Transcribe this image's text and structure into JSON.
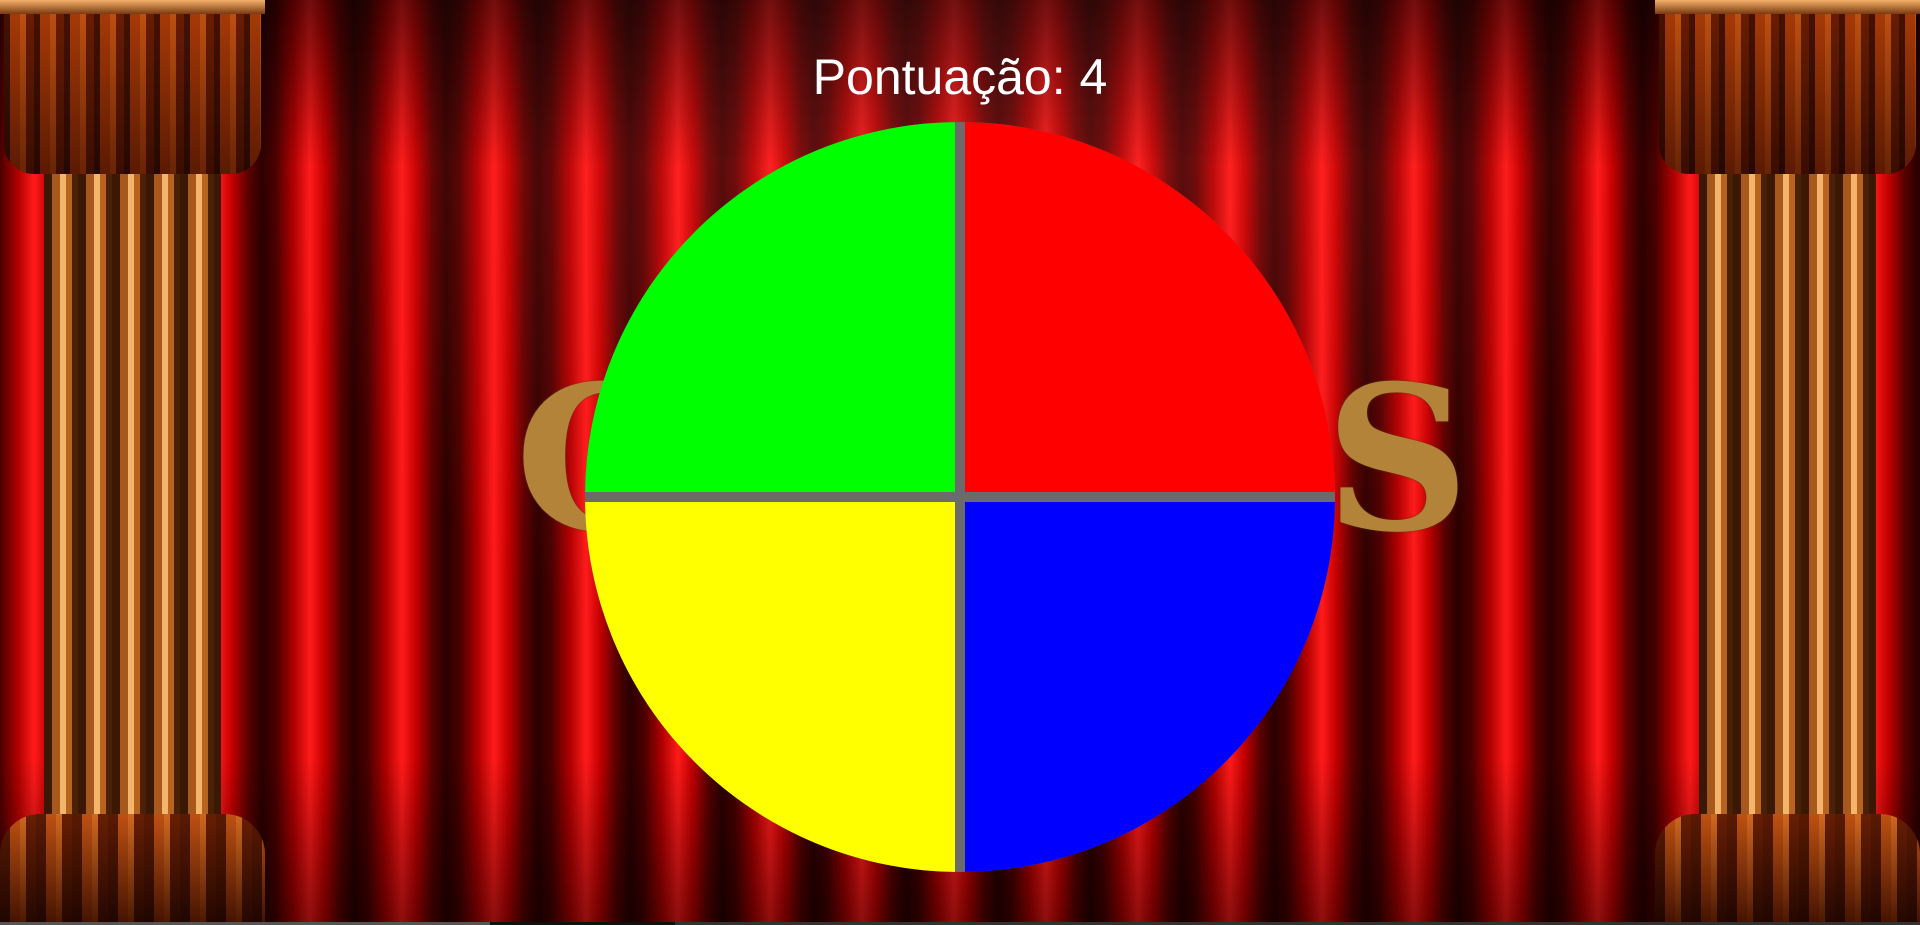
{
  "score": {
    "text": "Pontuação: 4"
  },
  "background": {
    "curtain_color": "#d00000",
    "pillar_color": "#c87a30",
    "title_color": "#b3833a",
    "title_left_letter": "C",
    "title_right_letter": "S"
  },
  "wheel": {
    "divider_color": "#6b6b6b",
    "quadrants": [
      {
        "name": "green",
        "color": "#00ff00"
      },
      {
        "name": "red",
        "color": "#ff0000"
      },
      {
        "name": "yellow",
        "color": "#ffff00"
      },
      {
        "name": "blue",
        "color": "#0000ff"
      }
    ]
  }
}
